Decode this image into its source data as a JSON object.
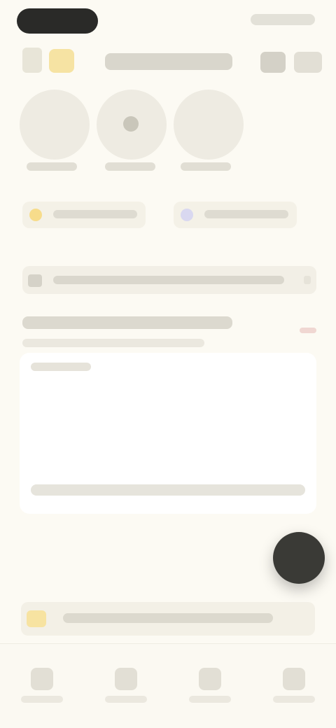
{
  "colors": {
    "background": "#fcfaf3",
    "status_pill": "#2a2a28",
    "accent_yellow": "#f6e3a3",
    "accent_lavender": "#d9d8f0",
    "fab": "#3a3a36"
  },
  "icons": {
    "header_left": "hamburger-icon",
    "header_badge": "star-icon",
    "header_action_1": "search-icon",
    "header_action_2": "share-icon",
    "pill_1": "sun-icon",
    "pill_2": "shield-icon",
    "list_row": "gear-icon",
    "fab": "plus-icon",
    "banner": "lightbulb-icon",
    "nav": [
      "home-icon",
      "favorites-icon",
      "bell-icon",
      "profile-icon"
    ]
  }
}
